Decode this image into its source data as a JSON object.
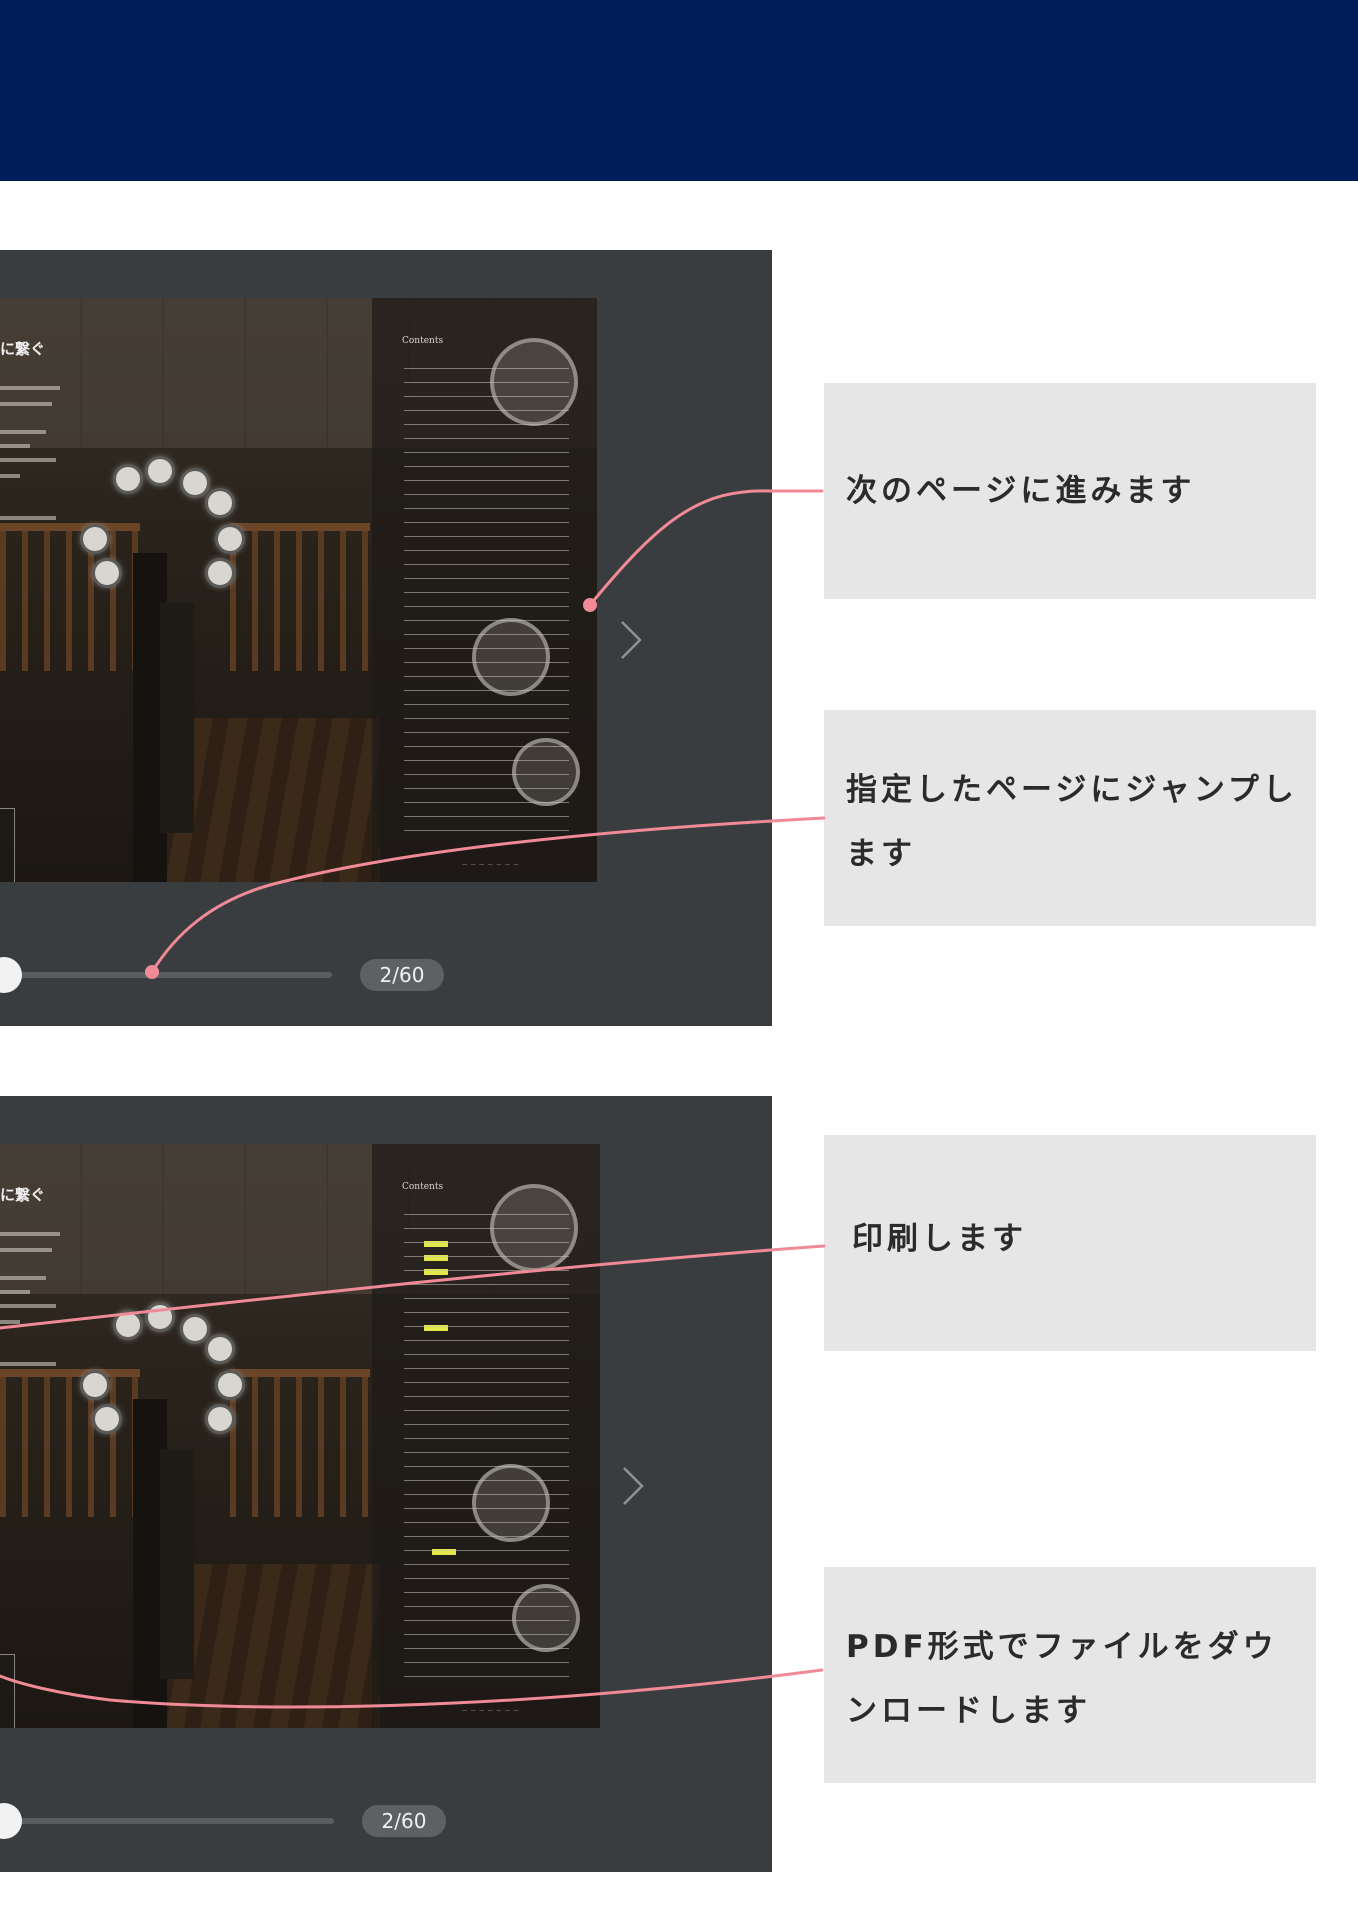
{
  "viewer": {
    "left_heading": "に繋ぐ",
    "contents_title": "Contents",
    "page_counter": "2/60",
    "slider_progress": 0.0
  },
  "callouts": {
    "next_page": "次のページに進みます",
    "jump_page": "指定したページにジャンプします",
    "print": "印刷します",
    "download_pdf": "PDF形式でファイルをダウンロードします"
  },
  "colors": {
    "header": "#001e5a",
    "viewer_bg": "#3a3d40",
    "callout_bg": "#e6e6e6",
    "connector": "#f08a96"
  },
  "icons": {
    "next_arrow": "chevron-right-icon"
  }
}
